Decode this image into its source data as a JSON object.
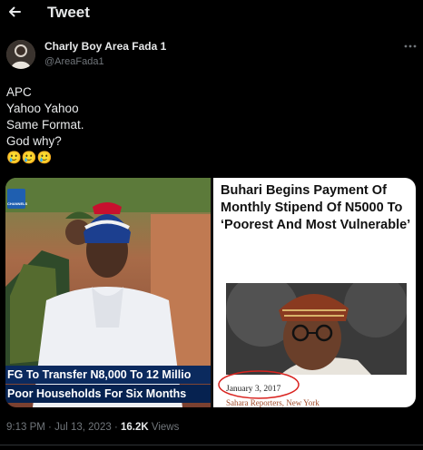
{
  "header": {
    "title": "Tweet"
  },
  "author": {
    "name": "Charly Boy Area Fada 1",
    "handle": "@AreaFada1"
  },
  "tweet": {
    "lines": [
      "APC",
      "Yahoo Yahoo",
      "Same Format.",
      "God why?",
      "🥲🥲🥲"
    ]
  },
  "media": {
    "left": {
      "channel_logo": "CHANNELS",
      "caption_line1": "FG To Transfer N8,000 To 12 Millio",
      "caption_line2": "Poor Households For Six Months"
    },
    "right": {
      "headline": "Buhari Begins Payment Of Monthly Stipend Of N5000 To ‘Poorest And Most Vulnerable’",
      "date": "January 3, 2017",
      "source": "Sahara Reporters, New York"
    }
  },
  "meta": {
    "time": "9:13 PM",
    "date": "Jul 13, 2023",
    "views_count": "16.2K",
    "views_label": "Views",
    "separator": "·"
  },
  "colors": {
    "background": "#000000",
    "text": "#e7e9ea",
    "muted": "#71767b",
    "caption_bg": "#0b2a5e"
  }
}
